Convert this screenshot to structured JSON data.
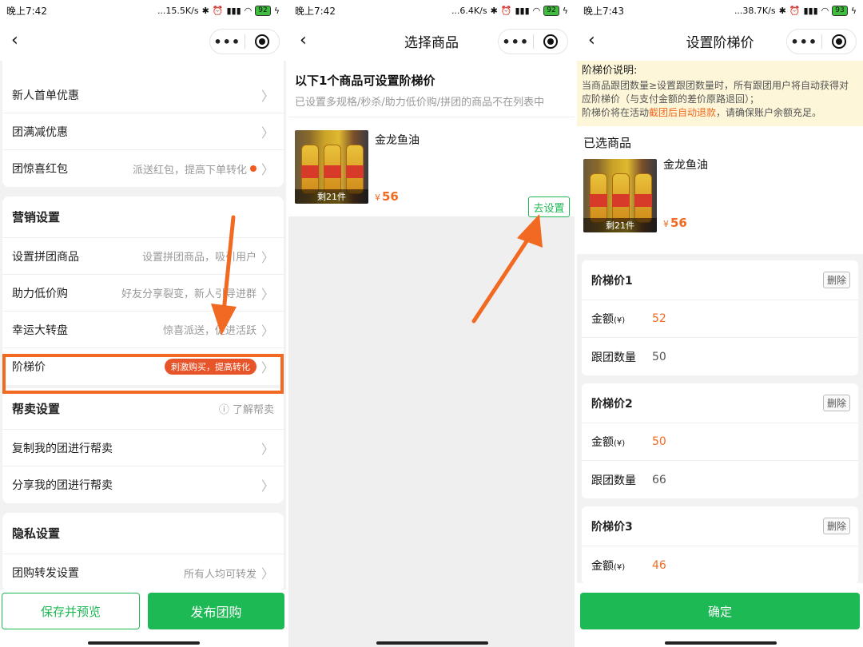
{
  "status": {
    "p1_time": "晚上7:42",
    "p1_speed": "...15.5K/s",
    "p1_battery": "92",
    "p2_time": "晚上7:42",
    "p2_speed": "...6.4K/s",
    "p2_battery": "92",
    "p3_time": "晚上7:43",
    "p3_speed": "...38.7K/s",
    "p3_battery": "93"
  },
  "panel1": {
    "top_rows": [
      {
        "label": "新人首单优惠",
        "hint": ""
      },
      {
        "label": "团满减优惠",
        "hint": ""
      },
      {
        "label": "团惊喜红包",
        "hint": "派送红包，提高下单转化"
      }
    ],
    "marketing": {
      "title": "营销设置",
      "rows": [
        {
          "label": "设置拼团商品",
          "hint": "设置拼团商品，吸引用户"
        },
        {
          "label": "助力低价购",
          "hint": "好友分享裂变，新人引导进群"
        },
        {
          "label": "幸运大转盘",
          "hint": "惊喜派送，促进活跃"
        },
        {
          "label": "阶梯价",
          "badge": "刺激购买，提高转化"
        }
      ]
    },
    "resell": {
      "title": "帮卖设置",
      "help": "了解帮卖",
      "rows": [
        {
          "label": "复制我的团进行帮卖"
        },
        {
          "label": "分享我的团进行帮卖"
        }
      ]
    },
    "privacy": {
      "title": "隐私设置",
      "rows": [
        {
          "label": "团购转发设置",
          "hint": "所有人均可转发"
        }
      ]
    },
    "buttons": {
      "preview": "保存并预览",
      "publish": "发布团购"
    }
  },
  "panel2": {
    "title": "选择商品",
    "heading": "以下1个商品可设置阶梯价",
    "subheading": "已设置多规格/秒杀/助力低价购/拼团的商品不在列表中",
    "product": {
      "name": "金龙鱼油",
      "stock": "剩21件",
      "currency": "¥",
      "price": "56",
      "action": "去设置"
    }
  },
  "panel3": {
    "title": "设置阶梯价",
    "notice": {
      "title": "阶梯价说明:",
      "line1": "当商品跟团数量≥设置跟团数量时，所有跟团用户将自动获得对应阶梯价（与支付金额的差价原路退回）；",
      "line2_pre": "阶梯价将在活动",
      "line2_em": "截团后自动退款",
      "line2_post": "，请确保账户余额充足。"
    },
    "selected": {
      "title": "已选商品",
      "name": "金龙鱼油",
      "stock": "剩21件",
      "currency": "¥",
      "price": "56"
    },
    "tiers": [
      {
        "title": "阶梯价1",
        "delete": "删除",
        "amount_label": "金额",
        "amount_unit": "(¥)",
        "amount": "52",
        "qty_label": "跟团数量",
        "qty": "50"
      },
      {
        "title": "阶梯价2",
        "delete": "删除",
        "amount_label": "金额",
        "amount_unit": "(¥)",
        "amount": "50",
        "qty_label": "跟团数量",
        "qty": "66"
      },
      {
        "title": "阶梯价3",
        "delete": "删除",
        "amount_label": "金额",
        "amount_unit": "(¥)",
        "amount": "46"
      }
    ],
    "confirm": "确定"
  },
  "colors": {
    "accent_green": "#1db954",
    "highlight_orange": "#f26a22",
    "price_orange": "#f06a20"
  }
}
